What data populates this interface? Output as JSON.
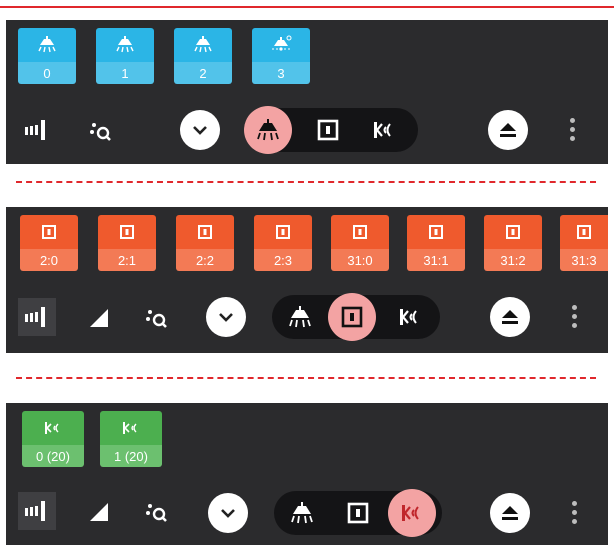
{
  "panels": [
    {
      "tile_icon": "lamp-icon",
      "tiles": [
        {
          "label": "0",
          "icon": "lamp-icon"
        },
        {
          "label": "1",
          "icon": "lamp-icon"
        },
        {
          "label": "2",
          "icon": "lamp-icon"
        },
        {
          "label": "3",
          "icon": "lamp-dimmer-icon"
        }
      ],
      "selected_mode": "lamp"
    },
    {
      "tile_icon": "square-frame-icon",
      "tiles": [
        {
          "label": "2:0"
        },
        {
          "label": "2:1"
        },
        {
          "label": "2:2"
        },
        {
          "label": "2:3"
        },
        {
          "label": "31:0"
        },
        {
          "label": "31:1"
        },
        {
          "label": "31:2"
        },
        {
          "label": "31:3"
        }
      ],
      "selected_mode": "frame"
    },
    {
      "tile_icon": "nfc-signal-icon",
      "tiles": [
        {
          "label": "0 (20)"
        },
        {
          "label": "1 (20)"
        }
      ],
      "selected_mode": "signal"
    }
  ],
  "colors": {
    "blue": "#2bb5e6",
    "orange": "#ef5a2d",
    "green": "#4caf4f",
    "selected": "#f3a3a3",
    "panel": "#2b2b2d",
    "separator": "#e0282c"
  },
  "icons": [
    "signal-bars-icon",
    "triangle-signal-icon",
    "scan-search-icon",
    "chevron-down-icon",
    "eject-icon",
    "more-vert-icon"
  ]
}
